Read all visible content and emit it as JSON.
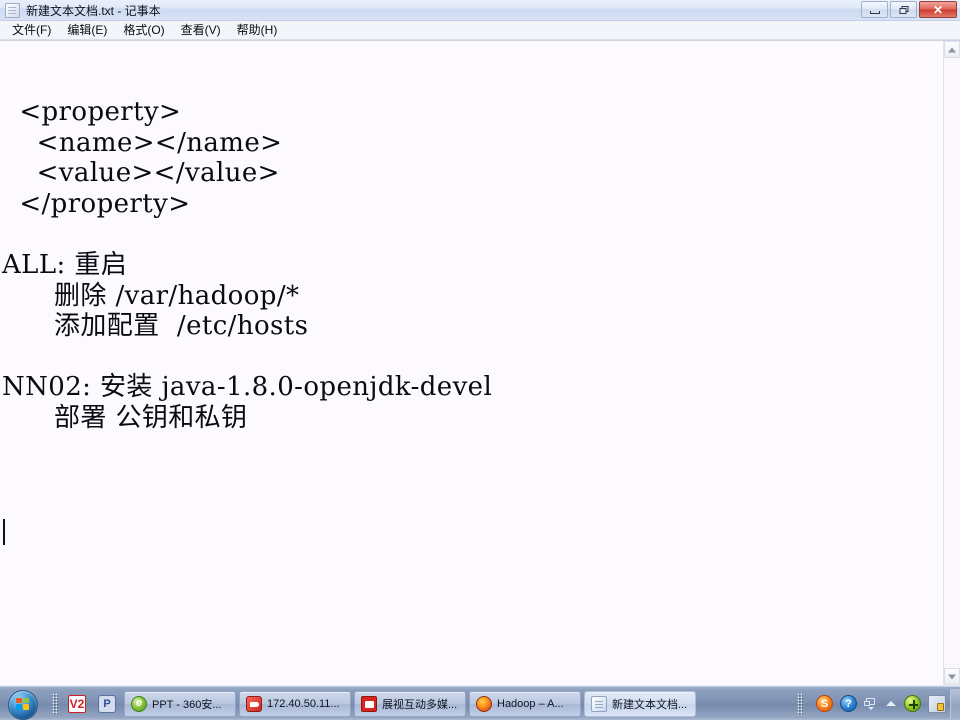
{
  "window": {
    "title": "新建文本文档.txt - 记事本",
    "icon": "notepad-document-icon",
    "controls": {
      "minimize_label": "最小化",
      "maximize_label": "还原",
      "close_label": "✕"
    }
  },
  "menu": {
    "items": [
      {
        "label": "文件(F)",
        "name": "menu-file"
      },
      {
        "label": "编辑(E)",
        "name": "menu-edit"
      },
      {
        "label": "格式(O)",
        "name": "menu-format"
      },
      {
        "label": "查看(V)",
        "name": "menu-view"
      },
      {
        "label": "帮助(H)",
        "name": "menu-help"
      }
    ]
  },
  "editor": {
    "content": "  <property>\n    <name></name>\n    <value></value>\n  </property>\n\nALL: 重启\n      删除 /var/hadoop/*\n      添加配置  /etc/hosts\n\nNN02: 安装 java-1.8.0-openjdk-devel\n      部署 公钥和私钥\n",
    "lines": [
      "  <property>",
      "    <name></name>",
      "    <value></value>",
      "  </property>",
      "",
      "ALL: 重启",
      "      删除 /var/hadoop/*",
      "      添加配置  /etc/hosts",
      "",
      "NN02: 安装 java-1.8.0-openjdk-devel",
      "      部署 公钥和私钥",
      ""
    ],
    "caret_visible": true
  },
  "scrollbar": {
    "up_arrow": "scroll-up-arrow",
    "down_arrow": "scroll-down-arrow"
  },
  "taskbar": {
    "start_label": "开始",
    "quick_launch": [
      {
        "label": "V2",
        "name": "quicklaunch-ve-icon"
      },
      {
        "label": "P",
        "name": "quicklaunch-powerpoint-icon"
      }
    ],
    "tasks": [
      {
        "label": "PPT - 360安...",
        "icon": "ie-browser-icon",
        "active": false,
        "name": "taskbar-item-ppt"
      },
      {
        "label": "172.40.50.11...",
        "icon": "xshell-icon",
        "active": false,
        "name": "taskbar-item-xshell"
      },
      {
        "label": "展视互动多媒...",
        "icon": "media-icon",
        "active": false,
        "name": "taskbar-item-media"
      },
      {
        "label": "Hadoop – A...",
        "icon": "firefox-icon",
        "active": false,
        "name": "taskbar-item-hadoop"
      },
      {
        "label": "新建文本文档...",
        "icon": "notepad-icon",
        "active": true,
        "name": "taskbar-item-notepad"
      }
    ],
    "tray": [
      {
        "label": "S",
        "name": "tray-sogou-input-icon"
      },
      {
        "label": "?",
        "name": "tray-help-icon"
      },
      {
        "label": "",
        "name": "tray-network-icon"
      },
      {
        "label": "",
        "name": "tray-show-hidden-icons-chevron"
      },
      {
        "label": "",
        "name": "tray-360-safe-icon"
      },
      {
        "label": "",
        "name": "tray-security-icon"
      }
    ]
  },
  "colors": {
    "titlebar": "#dfe8f8",
    "close_button": "#cb3b2c",
    "editor_bg": "#fdfaff",
    "taskbar": "#7d90b2",
    "text": "#0a0a12"
  }
}
